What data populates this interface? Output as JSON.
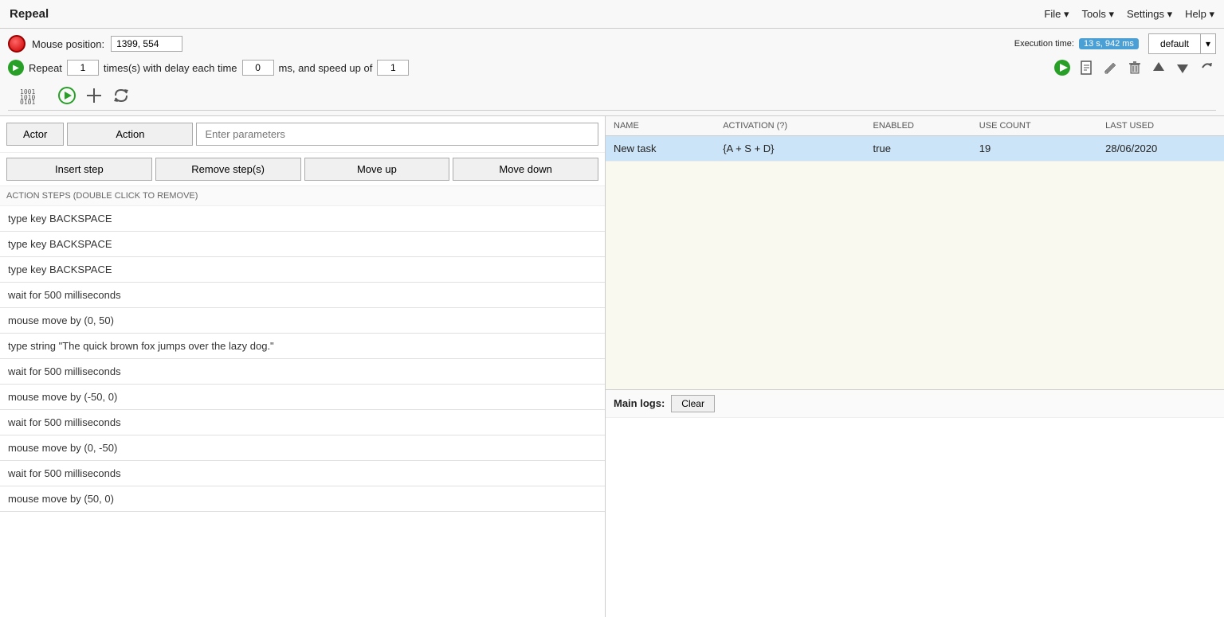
{
  "app": {
    "title": "Repeal",
    "menu_items": [
      "File",
      "Tools",
      "Settings",
      "Help"
    ]
  },
  "toolbar": {
    "mouse_position_label": "Mouse position:",
    "mouse_position_value": "1399, 554",
    "repeat_label": "Repeat",
    "repeat_value": "1",
    "times_label": "times(s) with delay each time",
    "delay_value": "0",
    "ms_label": "ms, and speed up of",
    "speed_value": "1",
    "default_btn": "default",
    "execution_time_label": "Execution time:",
    "execution_time_value": "13 s, 942 ms"
  },
  "editor": {
    "actor_btn": "Actor",
    "action_btn": "Action",
    "params_placeholder": "Enter parameters",
    "insert_step_btn": "Insert step",
    "remove_step_btn": "Remove step(s)",
    "move_up_btn": "Move up",
    "move_down_btn": "Move down",
    "action_steps_label": "ACTION STEPS (DOUBLE CLICK TO REMOVE)",
    "steps": [
      "type key BACKSPACE",
      "type key BACKSPACE",
      "type key BACKSPACE",
      "wait for 500 milliseconds",
      "mouse move by (0, 50)",
      "type string \"The quick brown fox jumps over the lazy dog.\"",
      "wait for 500 milliseconds",
      "mouse move by (-50, 0)",
      "wait for 500 milliseconds",
      "mouse move by (0, -50)",
      "wait for 500 milliseconds",
      "mouse move by (50, 0)"
    ]
  },
  "tasks_table": {
    "columns": [
      "NAME",
      "ACTIVATION (?)",
      "ENABLED",
      "USE COUNT",
      "LAST USED"
    ],
    "rows": [
      {
        "name": "New task",
        "activation": "{A + S + D}",
        "enabled": "true",
        "use_count": "19",
        "last_used": "28/06/2020",
        "selected": true
      }
    ]
  },
  "logs": {
    "label": "Main logs:",
    "clear_btn": "Clear"
  },
  "icons": {
    "play": "▶",
    "record": "⏺",
    "stop": "⏹",
    "refresh": "↺",
    "new": "📄",
    "edit": "✏",
    "delete": "🗑",
    "up": "▲",
    "down": "▼",
    "redo": "↻"
  }
}
